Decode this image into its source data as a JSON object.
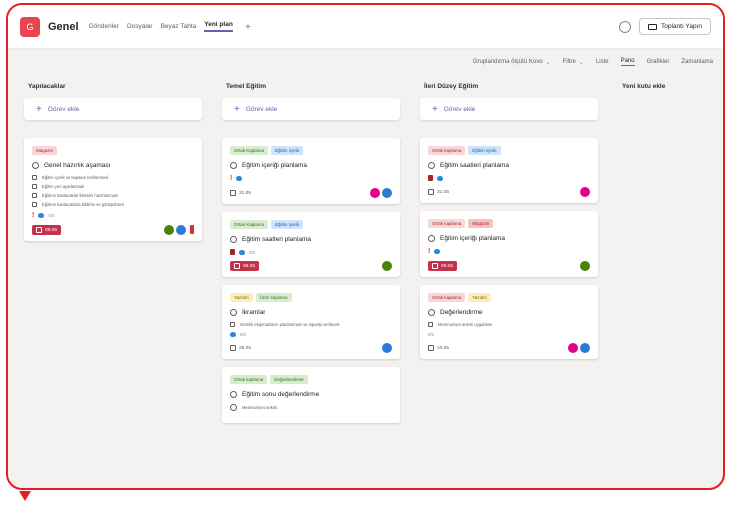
{
  "header": {
    "team_badge": "G",
    "channel": "Genel",
    "tabs": [
      "Gönderiler",
      "Dosyalar",
      "Beyaz Tahta",
      "Yeni plan"
    ],
    "active_tab": "Yeni plan",
    "add_tab": "+",
    "meet_label": "Toplantı Yapın"
  },
  "toolbar": {
    "filter": "Gruplandırma ölçütü Kovo",
    "filter_2": "Filtre",
    "views": [
      "Liste",
      "Pano",
      "Grafikler",
      "Zamanlama"
    ],
    "active_view": "Pano"
  },
  "board": {
    "add_task_label": "Görev ekle",
    "columns": [
      {
        "title": "Yapılacaklar",
        "cards": [
          {
            "labels": [
              "Magazin"
            ],
            "title": "Genel hazırlık aşaması",
            "checklist": [
              "Eğitim içerik ve kapsam belirlenmeli",
              "Eğitim yeri ayarlanmalı",
              "Eğitime katılacaklar listesini hazırlanması",
              "Eğitime katılacaklara bildirim ve görüşülmesi"
            ],
            "subcount": "0/4",
            "date": "09.05"
          }
        ]
      },
      {
        "title": "Temel Eğitim",
        "cards": [
          {
            "labels": [
              "Ortak Kaplama",
              "Eğitim içerik"
            ],
            "title": "Eğitim içeriği planlama",
            "date": "31.05"
          },
          {
            "labels": [
              "Ortak Kaplama",
              "Eğitim içerik"
            ],
            "title": "Eğitim saatleri planlama",
            "subcount": "0/1",
            "date": "06.05"
          },
          {
            "labels": [
              "Yazılım",
              "Ürün kaplama"
            ],
            "title": "İkramlar",
            "checklist": [
              "Gerekli ekipmanların planlanması ve siparişi verilecek"
            ],
            "subcount": "0/1",
            "date": "28.05"
          },
          {
            "labels": [
              "Ortak kaplama",
              "Değerlendirme"
            ],
            "title": "Eğitim sonu değerlendirme",
            "checklist": [
              "Memnuniyet anketi"
            ]
          }
        ]
      },
      {
        "title": "İleri Düzey Eğitim",
        "cards": [
          {
            "labels": [
              "Ortak kaplama",
              "Eğitim içerik"
            ],
            "title": "Eğitim saatleri planlama",
            "date": "31.05"
          },
          {
            "labels": [
              "Ortak kaplama",
              "Magazin"
            ],
            "title": "Eğitim içeriği planlama",
            "date": "09.05"
          },
          {
            "labels": [
              "Ortak kaplama",
              "Yazılım"
            ],
            "title": "Değerlendirme",
            "checklist": [
              "Memnuniyet anketi uygulama"
            ],
            "subcount": "0/1",
            "date": "10.05"
          }
        ]
      },
      {
        "title": "Yeni kutu ekle",
        "cards": []
      }
    ]
  },
  "colors": {
    "frame": "#e31e24",
    "accent": "#6264a7",
    "overdue": "#c4314b"
  }
}
